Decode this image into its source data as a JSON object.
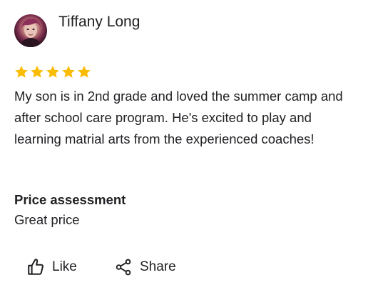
{
  "reviewer": {
    "name": "Tiffany Long",
    "avatar_icon": "avatar-photo"
  },
  "rating": {
    "stars": 5,
    "max": 5,
    "star_color": "#fbbc04"
  },
  "review": {
    "text": "My son is in 2nd grade and loved the summer camp and after school care program. He's excited to play and learning matrial arts from the experienced coaches!"
  },
  "price_assessment": {
    "heading": "Price assessment",
    "value": "Great price"
  },
  "actions": {
    "like_label": "Like",
    "like_icon": "thumbs-up-icon",
    "share_label": "Share",
    "share_icon": "share-icon"
  }
}
